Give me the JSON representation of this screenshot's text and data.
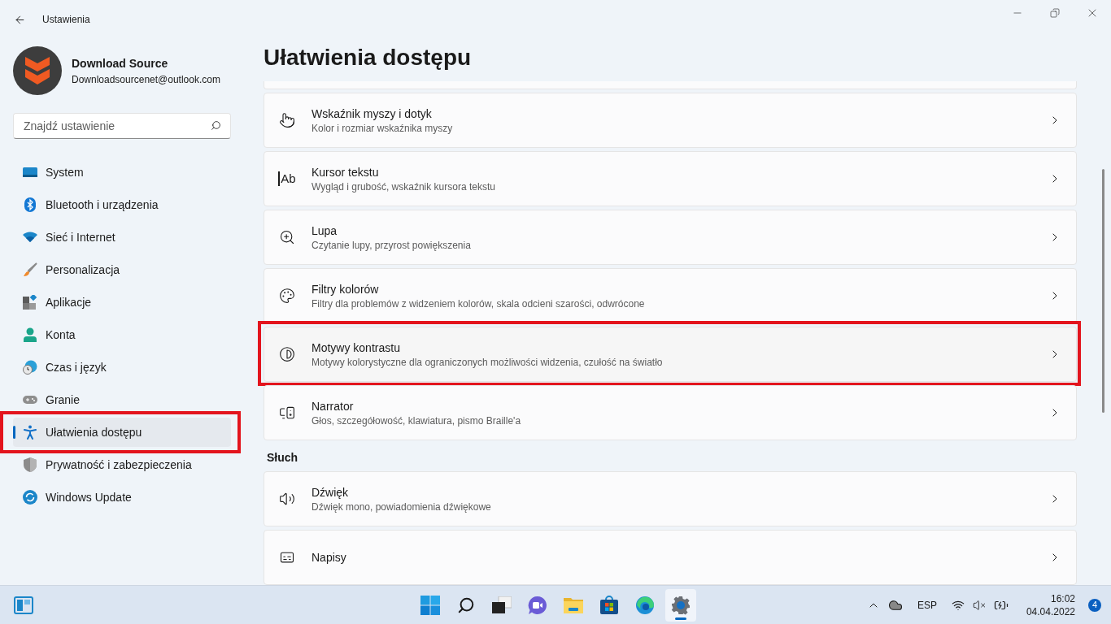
{
  "window": {
    "title": "Ustawienia"
  },
  "account": {
    "name": "Download Source",
    "email": "Downloadsourcenet@outlook.com"
  },
  "search": {
    "placeholder": "Znajdź ustawienie"
  },
  "nav": [
    {
      "label": "System",
      "selected": false,
      "highlighted": false
    },
    {
      "label": "Bluetooth i urządzenia",
      "selected": false,
      "highlighted": false
    },
    {
      "label": "Sieć i Internet",
      "selected": false,
      "highlighted": false
    },
    {
      "label": "Personalizacja",
      "selected": false,
      "highlighted": false
    },
    {
      "label": "Aplikacje",
      "selected": false,
      "highlighted": false
    },
    {
      "label": "Konta",
      "selected": false,
      "highlighted": false
    },
    {
      "label": "Czas i język",
      "selected": false,
      "highlighted": false
    },
    {
      "label": "Granie",
      "selected": false,
      "highlighted": false
    },
    {
      "label": "Ułatwienia dostępu",
      "selected": true,
      "highlighted": true
    },
    {
      "label": "Prywatność i zabezpieczenia",
      "selected": false,
      "highlighted": false
    },
    {
      "label": "Windows Update",
      "selected": false,
      "highlighted": false
    }
  ],
  "page_title": "Ułatwienia dostępu",
  "sections": [
    {
      "items": [
        {
          "title": "Wskaźnik myszy i dotyk",
          "subtitle": "Kolor i rozmiar wskaźnika myszy",
          "highlighted": false
        },
        {
          "title": "Kursor tekstu",
          "icon_text": "Ab",
          "subtitle": "Wygląd i grubość, wskaźnik kursora tekstu",
          "highlighted": false
        },
        {
          "title": "Lupa",
          "subtitle": "Czytanie lupy, przyrost powiększenia",
          "highlighted": false
        },
        {
          "title": "Filtry kolorów",
          "subtitle": "Filtry dla problemów z widzeniem kolorów, skala odcieni szarości, odwrócone",
          "highlighted": false
        },
        {
          "title": "Motywy kontrastu",
          "subtitle": "Motywy kolorystyczne dla ograniczonych możliwości widzenia, czułość na światło",
          "highlighted": true
        },
        {
          "title": "Narrator",
          "subtitle": "Głos, szczegółowość, klawiatura, pismo Braille'a",
          "highlighted": false
        }
      ]
    },
    {
      "heading": "Słuch",
      "items": [
        {
          "title": "Dźwięk",
          "subtitle": "Dźwięk mono, powiadomienia dźwiękowe",
          "highlighted": false
        },
        {
          "title": "Napisy",
          "highlighted": false
        }
      ]
    }
  ],
  "taskbar": {
    "apps": [
      {
        "selected": false
      },
      {
        "selected": false
      },
      {
        "selected": false
      },
      {
        "selected": false
      },
      {
        "selected": false
      },
      {
        "selected": false
      },
      {
        "selected": false
      },
      {
        "selected": true
      }
    ],
    "language": "ESP",
    "time": "16:02",
    "date": "04.04.2022",
    "notifications": "4"
  }
}
